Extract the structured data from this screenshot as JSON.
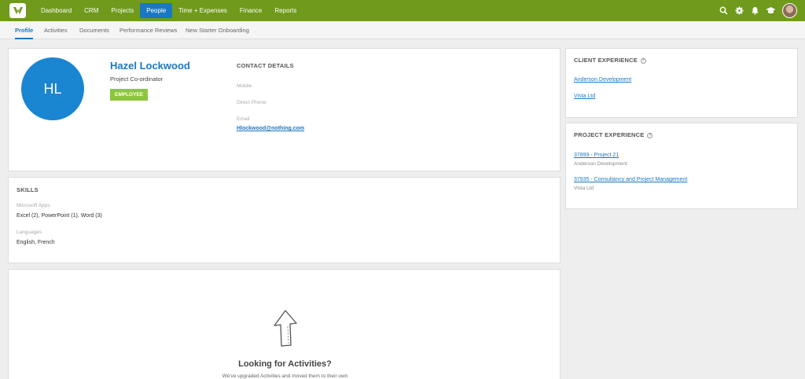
{
  "nav": {
    "items": [
      {
        "label": "Dashboard"
      },
      {
        "label": "CRM"
      },
      {
        "label": "Projects"
      },
      {
        "label": "People"
      },
      {
        "label": "Time + Expenses"
      },
      {
        "label": "Finance"
      },
      {
        "label": "Reports"
      }
    ],
    "active": "People",
    "icons": [
      "search-icon",
      "gear-icon",
      "bell-icon",
      "graduation-cap-icon"
    ]
  },
  "subnav": {
    "tabs": [
      {
        "label": "Profile"
      },
      {
        "label": "Activities"
      },
      {
        "label": "Documents"
      },
      {
        "label": "Performance Reviews"
      },
      {
        "label": "New Starter Onboarding"
      }
    ],
    "active": "Profile"
  },
  "profile": {
    "initials": "HL",
    "name": "Hazel Lockwood",
    "role": "Project Co-ordinator",
    "badge": "EMPLOYEE"
  },
  "contact": {
    "title": "CONTACT DETAILS",
    "mobile_label": "Mobile",
    "phone_label": "Direct Phone",
    "email_label": "Email",
    "email": "Hlockwood@nothing.com"
  },
  "skills": {
    "title": "SKILLS",
    "groups": [
      {
        "label": "Microsoft Apps",
        "value": "Excel (2), PowerPoint (1), Word (3)"
      },
      {
        "label": "Languages",
        "value": "English, French"
      }
    ]
  },
  "client_experience": {
    "title": "CLIENT EXPERIENCE",
    "help": "?",
    "items": [
      {
        "label": "Anderson Development"
      },
      {
        "label": "Vista Ltd"
      }
    ]
  },
  "project_experience": {
    "title": "PROJECT EXPERIENCE",
    "help": "?",
    "items": [
      {
        "label": "37899 - Project 21",
        "client": "Anderson Development"
      },
      {
        "label": "37935 - Consultancy and Project Management",
        "client": "Vista Ltd"
      }
    ]
  },
  "activities": {
    "title": "Looking for Activities?",
    "text": "We've upgraded Activities and moved them to their own"
  },
  "colors": {
    "topbar": "#6f9a1b",
    "accent": "#1a78c2",
    "badge": "#8cc63f",
    "avatar": "#1a85d0"
  }
}
